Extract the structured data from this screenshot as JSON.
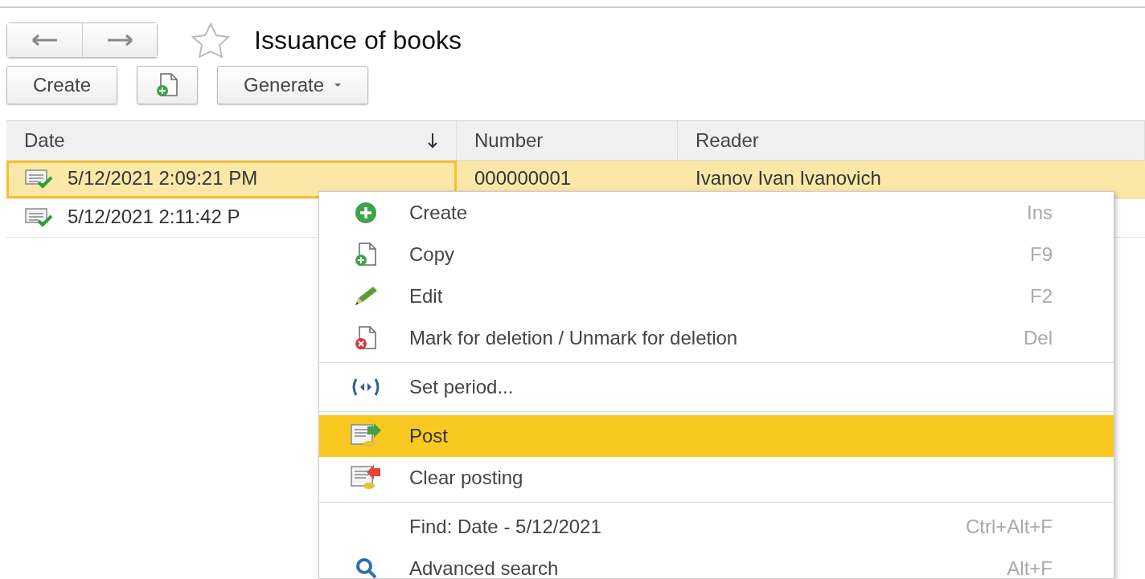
{
  "window": {
    "title": "Issuance of books",
    "favorite": false
  },
  "toolbar": {
    "buttons": [
      {
        "kind": "text",
        "label": "Create"
      },
      {
        "kind": "copy-icon"
      },
      {
        "kind": "dropdown",
        "label": "Generate"
      }
    ]
  },
  "table": {
    "columns": [
      {
        "label": "Date",
        "sorted_descending": true
      },
      {
        "label": "Number"
      },
      {
        "label": "Reader"
      }
    ],
    "rows": [
      {
        "selected": true,
        "posted": true,
        "cells": [
          "5/12/2021 2:09:21 PM",
          "000000001",
          "Ivanov Ivan Ivanovich"
        ]
      },
      {
        "selected": false,
        "posted": true,
        "cells": [
          "5/12/2021 2:11:42 P"
        ]
      }
    ]
  },
  "context_menu": {
    "sections": [
      {
        "items": [
          {
            "kind": "create",
            "label": "Create",
            "shortcut": "Ins",
            "selected": false
          },
          {
            "kind": "copy",
            "label": "Copy",
            "shortcut": "F9",
            "selected": false
          },
          {
            "kind": "edit",
            "label": "Edit",
            "shortcut": "F2",
            "selected": false
          },
          {
            "kind": "delete",
            "label": "Mark for deletion / Unmark for deletion",
            "shortcut": "Del",
            "selected": false
          }
        ]
      },
      {
        "items": [
          {
            "kind": "period",
            "label": "Set period...",
            "selected": false
          }
        ]
      },
      {
        "items": [
          {
            "kind": "post",
            "label": "Post",
            "selected": true
          },
          {
            "kind": "unpost",
            "label": "Clear posting",
            "selected": false
          }
        ]
      },
      {
        "items": [
          {
            "kind": "none",
            "label": "Find: Date - 5/12/2021",
            "shortcut": "Ctrl+Alt+F",
            "selected": false
          },
          {
            "kind": "search",
            "label": "Advanced search",
            "shortcut": "Alt+F",
            "selected": false
          }
        ]
      }
    ]
  }
}
